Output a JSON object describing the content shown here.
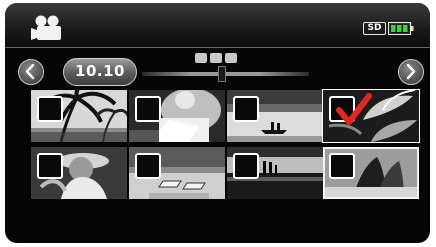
{
  "topbar": {
    "mode_icon": "video-camera-icon",
    "storage_label": "SD",
    "battery_icon": "battery-icon"
  },
  "navigation": {
    "prev_icon": "chevron-left-icon",
    "next_icon": "chevron-right-icon",
    "date_label": "10.10",
    "page_dots": 3
  },
  "thumbnails": [
    {
      "scene": "palm-trees",
      "checked": false
    },
    {
      "scene": "person-reading",
      "checked": false
    },
    {
      "scene": "canoe-lake",
      "checked": false
    },
    {
      "scene": "tropical-leaves",
      "checked": true
    },
    {
      "scene": "girl-hat",
      "checked": false
    },
    {
      "scene": "beach-chairs",
      "checked": false
    },
    {
      "scene": "couple-sunset",
      "checked": false
    },
    {
      "scene": "couple-walking",
      "checked": false
    }
  ],
  "colors": {
    "accent_check": "#e0281e",
    "background": "#050505",
    "battery_green": "#3fd13a"
  }
}
